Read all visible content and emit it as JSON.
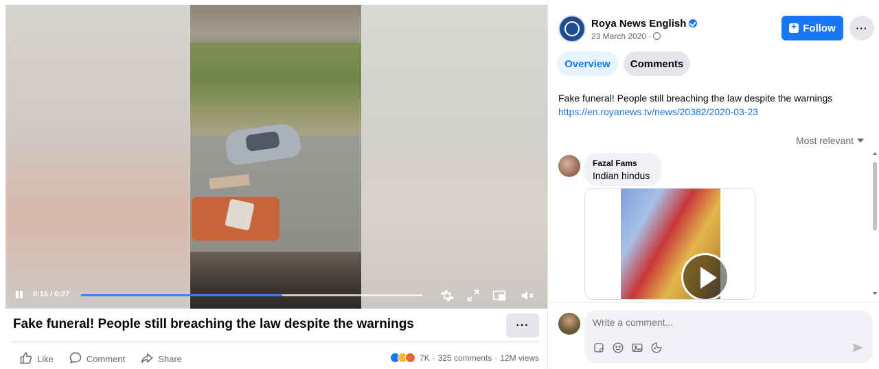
{
  "video": {
    "time": "0:16 / 0:27",
    "progress_fraction": 0.59
  },
  "post": {
    "title": "Fake funeral! People still breaching the law despite the warnings",
    "more_label": "···",
    "actions": {
      "like": "Like",
      "comment": "Comment",
      "share": "Share"
    },
    "stats": {
      "reactions": "7K",
      "separator1": "·",
      "comments": "325 comments",
      "separator2": "·",
      "views": "12M views"
    }
  },
  "page": {
    "name": "Roya News English",
    "date": "23 March 2020 ·",
    "follow_label": "Follow",
    "more_label": "···"
  },
  "tabs": {
    "overview": "Overview",
    "comments": "Comments"
  },
  "description": {
    "text": "Fake funeral! People still breaching the law despite the warnings",
    "link": "https://en.royanews.tv/news/20382/2020-03-23"
  },
  "comments": {
    "sort_label": "Most relevant",
    "items": [
      {
        "author": "Fazal Fams",
        "text": "Indian hindus"
      }
    ]
  },
  "composer": {
    "placeholder": "Write a comment..."
  },
  "colors": {
    "accent": "#1877f2",
    "link": "#216fdb",
    "progress": "#2d88ff"
  }
}
